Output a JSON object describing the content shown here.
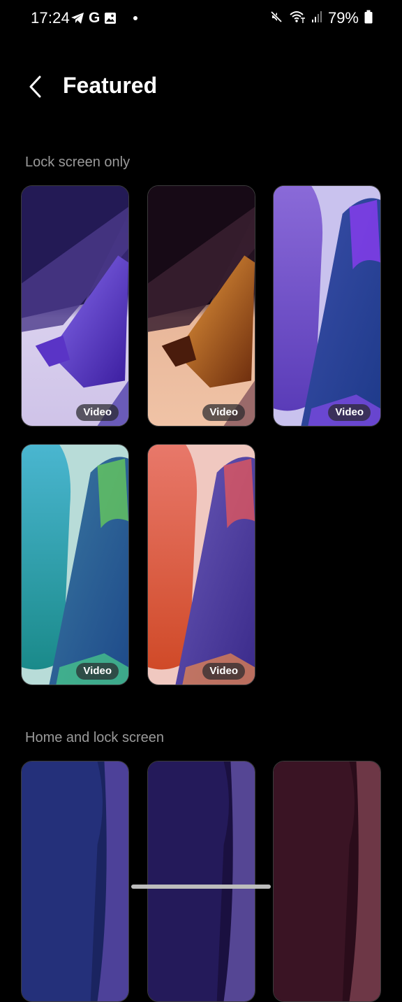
{
  "status_bar": {
    "time": "17:24",
    "battery": "79%",
    "icons": [
      "telegram-icon",
      "google-icon",
      "gallery-icon",
      "notification-dot-icon",
      "mute-icon",
      "wifi-calling-icon",
      "signal-icon",
      "battery-icon"
    ],
    "google_letter": "G"
  },
  "header": {
    "title": "Featured"
  },
  "sections": [
    {
      "title": "Lock screen only",
      "tiles": [
        {
          "badge": "Video",
          "palette": "purple-lilac"
        },
        {
          "badge": "Video",
          "palette": "amber-peach"
        },
        {
          "badge": "Video",
          "palette": "violet-blue"
        },
        {
          "badge": "Video",
          "palette": "teal-green"
        },
        {
          "badge": "Video",
          "palette": "coral-indigo"
        }
      ]
    },
    {
      "title": "Home and lock screen",
      "tiles": [
        {
          "palette": "navy-blue"
        },
        {
          "palette": "deep-purple"
        },
        {
          "palette": "maroon"
        }
      ]
    }
  ]
}
